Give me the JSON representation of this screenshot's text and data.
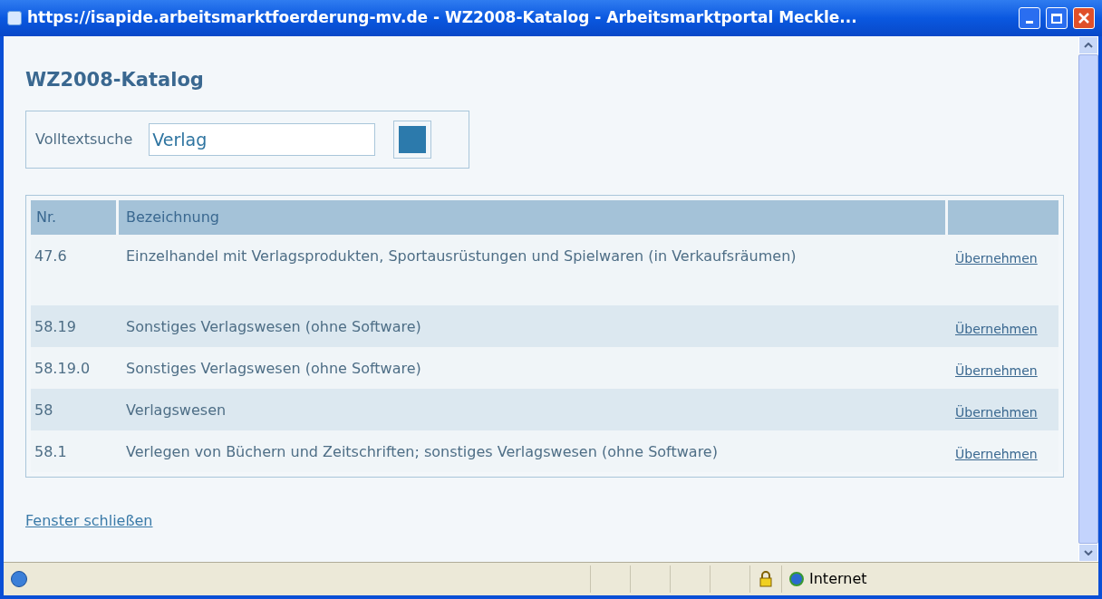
{
  "window": {
    "title": "https://isapide.arbeitsmarktfoerderung-mv.de - WZ2008-Katalog - Arbeitsmarktportal Meckle..."
  },
  "heading": "WZ2008-Katalog",
  "search": {
    "label": "Volltextsuche",
    "value": "Verlag"
  },
  "table": {
    "columns": [
      "Nr.",
      "Bezeichnung"
    ],
    "rows": [
      {
        "nr": "47.6",
        "text": "Einzelhandel mit Verlagsprodukten, Sportausrüstungen und Spielwaren (in Verkaufsräumen)",
        "action": "Übernehmen"
      },
      {
        "nr": "58.19",
        "text": "Sonstiges Verlagswesen (ohne Software)",
        "action": "Übernehmen"
      },
      {
        "nr": "58.19.0",
        "text": "Sonstiges Verlagswesen (ohne Software)",
        "action": "Übernehmen"
      },
      {
        "nr": "58",
        "text": "Verlagswesen",
        "action": "Übernehmen"
      },
      {
        "nr": "58.1",
        "text": "Verlegen von Büchern und Zeitschriften; sonstiges Verlagswesen (ohne Software)",
        "action": "Übernehmen"
      }
    ]
  },
  "close_link": "Fenster schließen",
  "status_bar": {
    "zone": "Internet"
  }
}
